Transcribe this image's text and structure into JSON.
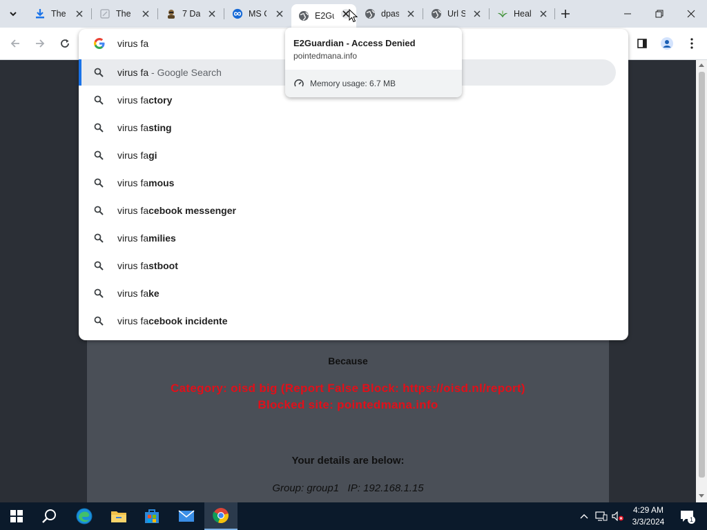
{
  "tabs": [
    {
      "title": "The",
      "icon": "download-icon"
    },
    {
      "title": "The",
      "icon": "page-icon"
    },
    {
      "title": "7 Da",
      "icon": "character-icon"
    },
    {
      "title": "MS C",
      "icon": "infinity-icon"
    },
    {
      "title": "E2Gu",
      "icon": "globe-icon",
      "active": true
    },
    {
      "title": "dpas",
      "icon": "globe-icon"
    },
    {
      "title": "Url S",
      "icon": "globe-icon"
    },
    {
      "title": "Heal",
      "icon": "leaf-icon"
    }
  ],
  "omnibox": {
    "query": "virus fa",
    "top_suggestion": {
      "text": "virus fa",
      "suffix": " - Google Search"
    },
    "suggestions": [
      {
        "prefix": "virus fa",
        "completion": "ctory"
      },
      {
        "prefix": "virus fa",
        "completion": "sting"
      },
      {
        "prefix": "virus fa",
        "completion": "gi"
      },
      {
        "prefix": "virus fa",
        "completion": "mous"
      },
      {
        "prefix": "virus fa",
        "completion": "cebook messenger"
      },
      {
        "prefix": "virus fa",
        "completion": "milies"
      },
      {
        "prefix": "virus fa",
        "completion": "stboot"
      },
      {
        "prefix": "virus fa",
        "completion": "ke"
      },
      {
        "prefix": "virus fa",
        "completion": "cebook incidente"
      }
    ]
  },
  "hovercard": {
    "title": "E2Guardian - Access Denied",
    "domain": "pointedmana.info",
    "memory": "Memory usage: 6.7 MB"
  },
  "page": {
    "because": "Because",
    "category_line": "Category: oisd big (Report False Block: https://oisd.nl/report)",
    "blocked_line": "Blocked site: pointedmana.info",
    "details_heading": "Your details are below:",
    "details": "Group: group1   IP: 192.168.1.15",
    "colors": {
      "blocked_text": "#e0101a",
      "card_bg": "#4a4f57",
      "page_bg": "#2b2f36"
    }
  },
  "taskbar": {
    "time": "4:29 AM",
    "date": "3/3/2024",
    "notification_count": "1"
  }
}
